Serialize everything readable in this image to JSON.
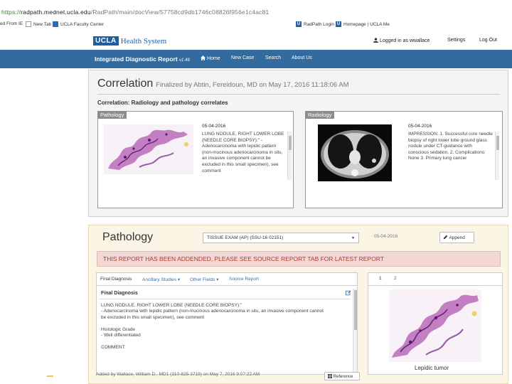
{
  "browser": {
    "url_scheme": "https://",
    "url_host": "radpath.mednet.ucla.edu",
    "url_path": "/RadPath/main/docView/57758cd9db1746c08826f956e1c4ac81",
    "bookmarks": [
      "ed From IE",
      "New Tab",
      "UCLA Faculty Center",
      "RadPath Login",
      "Homepage | UCLA Me"
    ]
  },
  "header": {
    "logo_box": "UCLA",
    "logo_text": "Health System",
    "logged_in": "Logged in as wwallace",
    "settings": "Settings",
    "logout": "Log Out"
  },
  "navbar": {
    "app_title": "Integrated Diagnostic Report",
    "version": "v1.49",
    "items": [
      "Home",
      "New Case",
      "Search",
      "About Us"
    ]
  },
  "correlation": {
    "title": "Correlation",
    "finalized": "Finalized by Abtin, Fereidoun, MD on May 17, 2016 11:18:06 AM",
    "subtitle_label": "Correlation:",
    "subtitle_value": "Radiology and pathology correlates",
    "pathology": {
      "tag": "Pathology",
      "date": "05-04-2016",
      "text": "LUNG NODULE, RIGHT LOWER LOBE (NEEDLE CORE BIOPSY):\" - Adenocarcinoma with lepidic pattern (non-mucinous adenocarcinoma in situ, an invasive component cannot be excluded in this small specimen), see comment"
    },
    "radiology": {
      "tag": "Radiology",
      "date": "05-04-2016",
      "text": "IMPRESSION: 1. Successful core needle biopsy of right lower lobe ground glass nodule under CT-guidance with conscious sedation. 2. Complications: None 3. Primary lung cancer"
    }
  },
  "pathology": {
    "title": "Pathology",
    "select_value": "TISSUE EXAM (AP) (SSU-16 02151)",
    "date": "05-04-2016",
    "append_label": "Append",
    "alert": "THIS REPORT HAS BEEN ADDENDED, PLEASE SEE SOURCE REPORT TAB FOR LATEST REPORT",
    "tabs": [
      "Final Diagnosis",
      "Ancillary Studies",
      "Other Fields",
      "Source Report"
    ],
    "report_heading": "Final Diagnosis",
    "report_lines": [
      "LUNG NODULE, RIGHT LOWER LOBE (NEEDLE CORE BIOPSY):\"",
      "- Adenocarcinoma with lepidic pattern (non-mucinous adenocarcinoma in situ, an invasive component cannot",
      "be excluded in this small specimen), see comment",
      "",
      "Histologic Grade",
      "- Well differentiated",
      "",
      "COMMENT:"
    ],
    "image_tabs": [
      "1",
      "2"
    ],
    "image_caption": "Lepidic tumor",
    "footer": "Added by Wallace, William D., MD1 (310-825-3719) on May 7, 2016 9:07:22 AM",
    "footer_button": "Reference"
  },
  "colors": {
    "navbar": "#336b9e",
    "alert_bg": "#f2d7d4",
    "alert_text": "#b03a2e",
    "pathology_bg": "#fbf5e6"
  }
}
